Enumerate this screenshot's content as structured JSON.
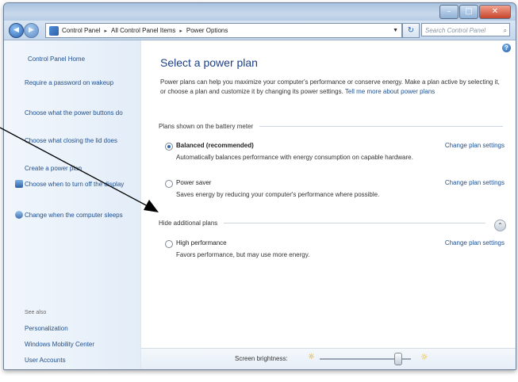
{
  "window": {
    "title_buttons": {
      "minimize": "–",
      "maximize": "□",
      "close": "✕"
    }
  },
  "nav": {
    "back_glyph": "◀",
    "forward_glyph": "▶",
    "breadcrumbs": [
      "Control Panel",
      "All Control Panel Items",
      "Power Options"
    ],
    "separator": "▸",
    "search_placeholder": "Search Control Panel",
    "refresh_glyph": "↻",
    "search_glyph": "⌕"
  },
  "sidebar": {
    "home": "Control Panel Home",
    "items": [
      {
        "label": "Require a password on wakeup",
        "icon": null
      },
      {
        "label": "Choose what the power buttons do",
        "icon": null
      },
      {
        "label": "Choose what closing the lid does",
        "icon": null
      },
      {
        "label": "Create a power plan",
        "icon": null
      },
      {
        "label": "Choose when to turn off the display",
        "icon": "display-icon"
      },
      {
        "label": "Change when the computer sleeps",
        "icon": "sleep-icon"
      }
    ],
    "see_also_header": "See also",
    "see_also": [
      "Personalization",
      "Windows Mobility Center",
      "User Accounts"
    ]
  },
  "main": {
    "help_glyph": "?",
    "title": "Select a power plan",
    "description": "Power plans can help you maximize your computer's performance or conserve energy. Make a plan active by selecting it, or choose a plan and customize it by changing its power settings.",
    "description_link": "Tell me more about power plans",
    "group1_label": "Plans shown on the battery meter",
    "plans": [
      {
        "name": "Balanced (recommended)",
        "desc": "Automatically balances performance with energy consumption on capable hardware.",
        "change": "Change plan settings",
        "selected": true
      },
      {
        "name": "Power saver",
        "desc": "Saves energy by reducing your computer's performance where possible.",
        "change": "Change plan settings",
        "selected": false
      }
    ],
    "group2_label": "Hide additional plans",
    "group2_chevron": "⌃",
    "extra_plan": {
      "name": "High performance",
      "desc": "Favors performance, but may use more energy.",
      "change": "Change plan settings",
      "selected": false
    },
    "brightness_label": "Screen brightness:",
    "brightness_level": 0.85,
    "sun_glyph": "☼"
  },
  "colors": {
    "link": "#1e4f8f",
    "title": "#1c3f86",
    "accent": "#2a6bb7"
  }
}
